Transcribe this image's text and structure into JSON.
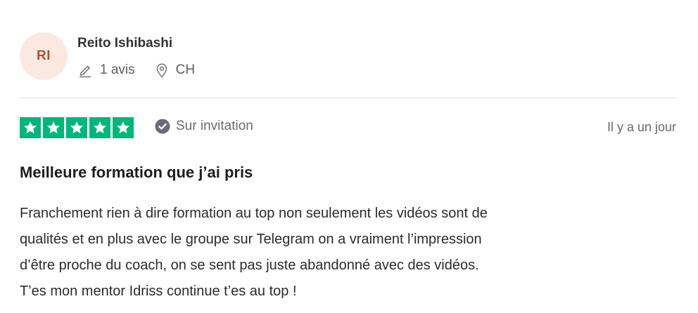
{
  "reviewer": {
    "initials": "RI",
    "name": "Reito Ishibashi",
    "review_count": "1 avis",
    "country": "CH",
    "avatar_bg": "#fbe9e1",
    "avatar_text_color": "#b0502e"
  },
  "rating": {
    "stars": 5,
    "max_stars": 5,
    "star_color": "#00b67a",
    "badge": "Sur invitation",
    "date": "Il y a un jour"
  },
  "review": {
    "title": "Meilleure formation que j’ai pris",
    "lines": [
      "Franchement rien à dire formation au top non seulement les vidéos sont de",
      "qualités et en plus avec le groupe sur Telegram on a vraiment l’impression",
      "d’être proche du coach, on se sent pas juste abandonné avec des vidéos.",
      "T’es mon mentor Idriss continue t’es au top !"
    ]
  },
  "icons": {
    "review_count": "pencil-icon",
    "country": "location-pin-icon",
    "badge": "check-circle-icon",
    "star": "star-icon"
  }
}
